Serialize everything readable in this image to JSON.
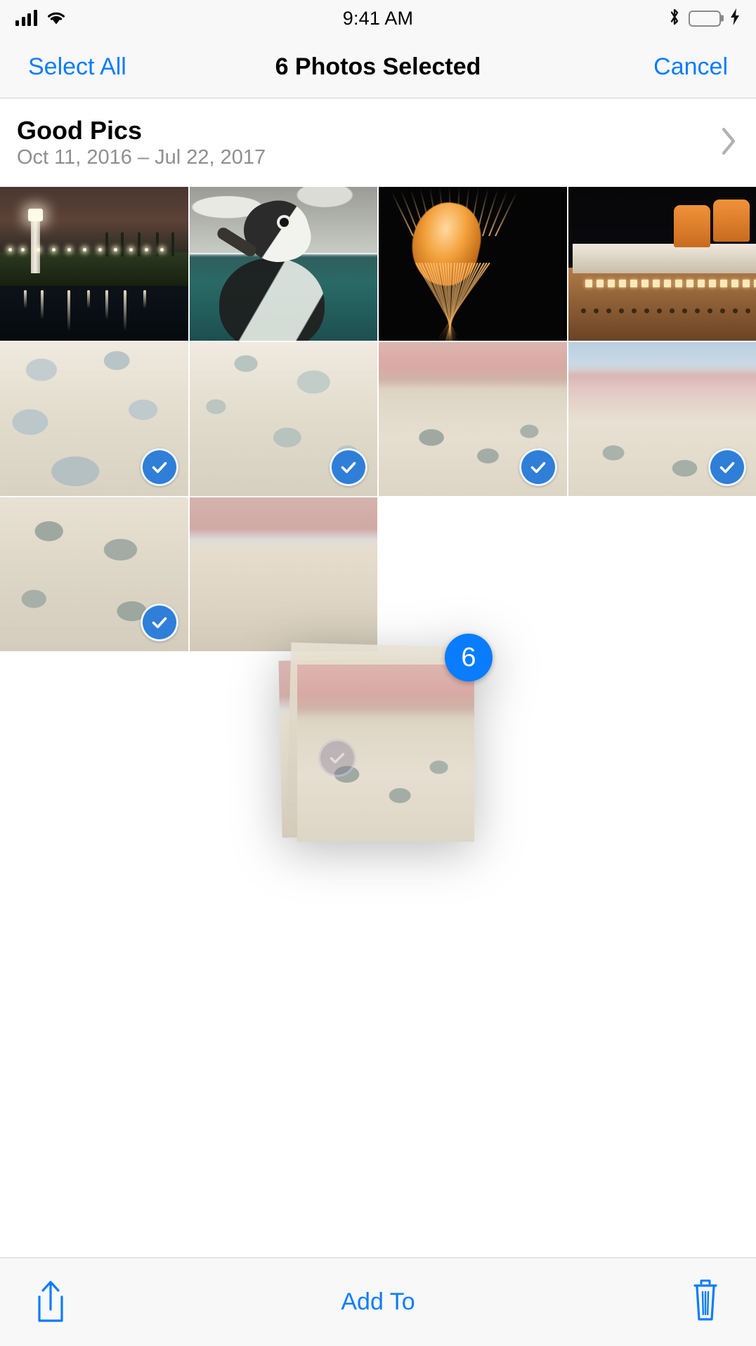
{
  "status_bar": {
    "time": "9:41 AM",
    "signal_bars": 4,
    "wifi_icon": "wifi-icon",
    "bluetooth_icon": "bluetooth-icon",
    "battery_icon": "battery-icon",
    "battery_full": true,
    "charging_icon": "lightning-bolt-icon",
    "battery_color": "#4cd964"
  },
  "nav_bar": {
    "left_button": "Select All",
    "title": "6 Photos Selected",
    "right_button": "Cancel",
    "tint_color": "#0a7cff"
  },
  "album_header": {
    "title": "Good Pics",
    "dates": "Oct 11, 2016 – Jul 22, 2017",
    "chevron_icon": "chevron-right-icon"
  },
  "grid": {
    "photos": [
      {
        "id": 1,
        "label": "Lighthouse at night",
        "art": "art-lighthouse",
        "selected": false
      },
      {
        "id": 2,
        "label": "Penguin in water",
        "art": "art-penguin",
        "selected": false
      },
      {
        "id": 3,
        "label": "Orange jellyfish",
        "art": "art-jelly",
        "selected": false
      },
      {
        "id": 4,
        "label": "Ocean liner at night",
        "art": "art-ship",
        "selected": false
      },
      {
        "id": 5,
        "label": "Salt flat pools",
        "art": "salt salt-a",
        "selected": true
      },
      {
        "id": 6,
        "label": "Salt flat crust",
        "art": "salt salt-b",
        "selected": true
      },
      {
        "id": 7,
        "label": "Pink salt shoreline",
        "art": "salt salt-c",
        "selected": true
      },
      {
        "id": 8,
        "label": "Pink lake horizon",
        "art": "salt salt-d",
        "selected": true
      },
      {
        "id": 9,
        "label": "Salt flat rocks",
        "art": "salt salt-e",
        "selected": true
      },
      {
        "id": 10,
        "label": "Pink salt bank",
        "art": "salt salt-f",
        "selected": false
      }
    ]
  },
  "drag_stack": {
    "badge_count": "6",
    "badge_color": "#0a7cff",
    "layers": [
      "salt salt-c",
      "salt salt-e",
      "salt salt-f"
    ]
  },
  "toolbar": {
    "share_icon": "share-icon",
    "add_to_label": "Add To",
    "trash_icon": "trash-icon",
    "tint_color": "#0a7cff"
  }
}
